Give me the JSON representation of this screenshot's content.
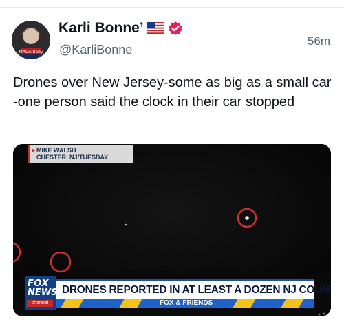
{
  "post": {
    "author": {
      "display_name": "Karli Bonne’",
      "flag_emoji_icon": "us-flag-icon",
      "verified_icon": "verified-badge-icon",
      "handle": "@KarliBonne",
      "avatar_caption": "MAGA Baby"
    },
    "timestamp": "56m",
    "text": "Drones over New Jersey-some as big as a small car -one person said the clock in their car stopped"
  },
  "video": {
    "lower_third": {
      "name": "MIKE WALSH",
      "location": "CHESTER, NJ/TUESDAY"
    },
    "logo": {
      "line1": "FOX",
      "line2": "NEWS",
      "line3": "channel"
    },
    "headline": "DRONES REPORTED IN AT LEAST A DOZEN NJ COUNTIES",
    "ticker": "FOX & FRIENDS"
  },
  "colors": {
    "verified_badge": "#e0245e",
    "circle_highlight": "#d32f2f",
    "fox_blue": "#153f85",
    "ticker_blue": "#1f62c9",
    "ticker_gold": "#f3c31c"
  }
}
